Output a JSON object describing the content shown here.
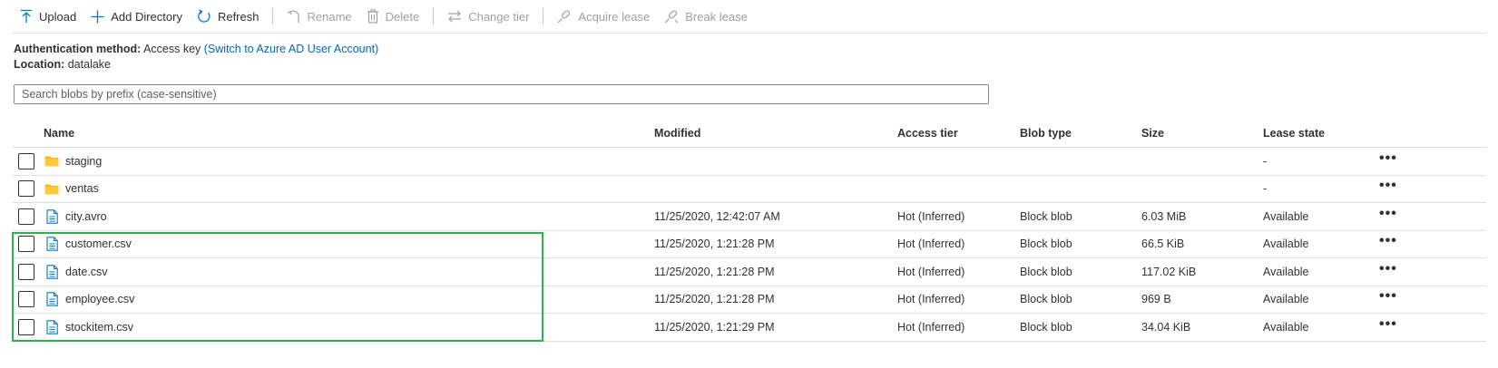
{
  "toolbar": {
    "upload": "Upload",
    "add_directory": "Add Directory",
    "refresh": "Refresh",
    "rename": "Rename",
    "delete": "Delete",
    "change_tier": "Change tier",
    "acquire_lease": "Acquire lease",
    "break_lease": "Break lease"
  },
  "info": {
    "auth_key": "Authentication method:",
    "auth_value": "Access key",
    "auth_link": "(Switch to Azure AD User Account)",
    "location_key": "Location:",
    "location_value": "datalake"
  },
  "search": {
    "placeholder": "Search blobs by prefix (case-sensitive)",
    "value": ""
  },
  "table": {
    "headers": {
      "name": "Name",
      "modified": "Modified",
      "access_tier": "Access tier",
      "blob_type": "Blob type",
      "size": "Size",
      "lease_state": "Lease state"
    },
    "rows": [
      {
        "icon": "folder-icon",
        "name": "staging",
        "modified": "",
        "access_tier": "",
        "blob_type": "",
        "size": "",
        "lease_state": "-",
        "more": "•••"
      },
      {
        "icon": "folder-icon",
        "name": "ventas",
        "modified": "",
        "access_tier": "",
        "blob_type": "",
        "size": "",
        "lease_state": "-",
        "more": "•••"
      },
      {
        "icon": "file-icon",
        "name": "city.avro",
        "modified": "11/25/2020, 12:42:07 AM",
        "access_tier": "Hot (Inferred)",
        "blob_type": "Block blob",
        "size": "6.03 MiB",
        "lease_state": "Available",
        "more": "•••"
      },
      {
        "icon": "file-icon",
        "name": "customer.csv",
        "modified": "11/25/2020, 1:21:28 PM",
        "access_tier": "Hot (Inferred)",
        "blob_type": "Block blob",
        "size": "66.5 KiB",
        "lease_state": "Available",
        "more": "•••"
      },
      {
        "icon": "file-icon",
        "name": "date.csv",
        "modified": "11/25/2020, 1:21:28 PM",
        "access_tier": "Hot (Inferred)",
        "blob_type": "Block blob",
        "size": "117.02 KiB",
        "lease_state": "Available",
        "more": "•••"
      },
      {
        "icon": "file-icon",
        "name": "employee.csv",
        "modified": "11/25/2020, 1:21:28 PM",
        "access_tier": "Hot (Inferred)",
        "blob_type": "Block blob",
        "size": "969 B",
        "lease_state": "Available",
        "more": "•••"
      },
      {
        "icon": "file-icon",
        "name": "stockitem.csv",
        "modified": "11/25/2020, 1:21:29 PM",
        "access_tier": "Hot (Inferred)",
        "blob_type": "Block blob",
        "size": "34.04 KiB",
        "lease_state": "Available",
        "more": "•••"
      }
    ]
  },
  "colors": {
    "accent": "#0078d4",
    "link": "#0067b8",
    "folder": "#ffb900",
    "highlight_box": "#2db34a",
    "disabled": "#a19f9d"
  }
}
